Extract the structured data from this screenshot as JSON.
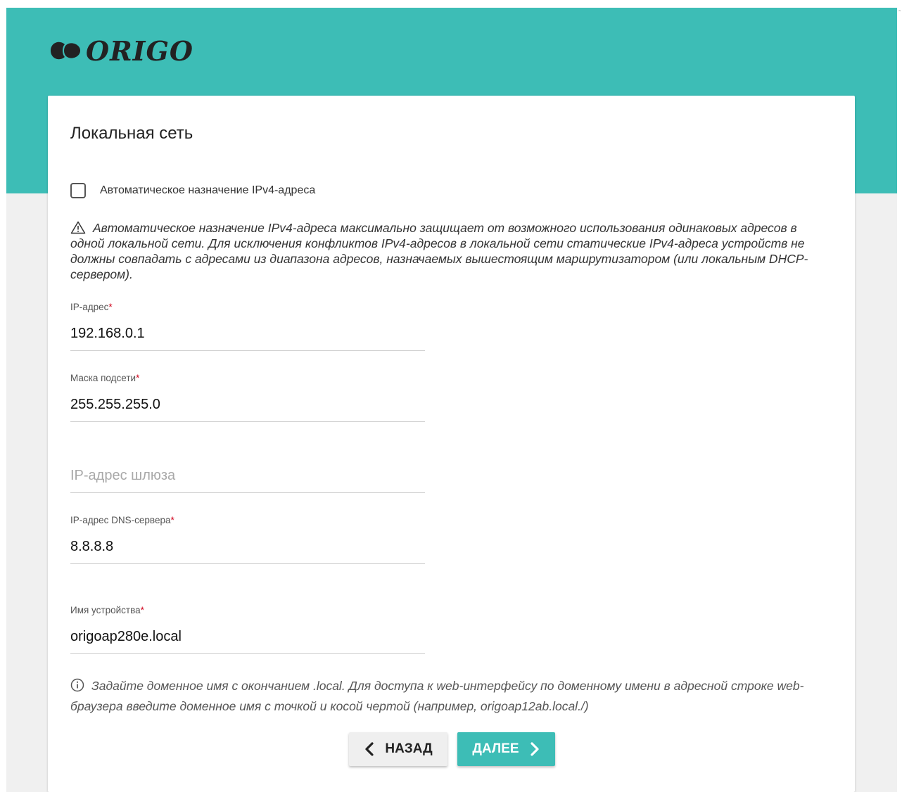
{
  "colors": {
    "accent": "#3dbdb6",
    "background": "#f0f0f0",
    "required": "#d0021b"
  },
  "logo": {
    "text": "ORIGO"
  },
  "page": {
    "title": "Локальная сеть"
  },
  "auto_ipv4": {
    "label": "Автоматическое назначение IPv4-адреса",
    "checked": false
  },
  "warning": {
    "icon": "warning-triangle-icon",
    "text": "Автоматическое назначение IPv4-адреса максимально защищает от возможного использования одинаковых адресов в одной локальной сети. Для исключения конфликтов IPv4-адресов в локальной сети статические IPv4-адреса устройств не должны совпадать с адресами из диапазона адресов, назначаемых вышестоящим маршрутизатором (или локальным DHCP-сервером)."
  },
  "fields": {
    "ip": {
      "label": "IP-адрес",
      "required_mark": "*",
      "value": "192.168.0.1"
    },
    "mask": {
      "label": "Маска подсети",
      "required_mark": "*",
      "value": "255.255.255.0"
    },
    "gateway": {
      "placeholder": "IP-адрес шлюза",
      "value": ""
    },
    "dns": {
      "label": "IP-адрес DNS-сервера",
      "required_mark": "*",
      "value": "8.8.8.8"
    },
    "device_name": {
      "label": "Имя устройства",
      "required_mark": "*",
      "value": "origoap280e.local"
    }
  },
  "hint": {
    "icon": "info-circle-icon",
    "text": "Задайте доменное имя с окончанием .local. Для доступа к web-интерфейсу по доменному имени в адресной строке web-браузера введите доменное имя с точкой и косой чертой (например, origoap12ab.local./)"
  },
  "buttons": {
    "back": "НАЗАД",
    "next": "ДАЛЕЕ"
  }
}
